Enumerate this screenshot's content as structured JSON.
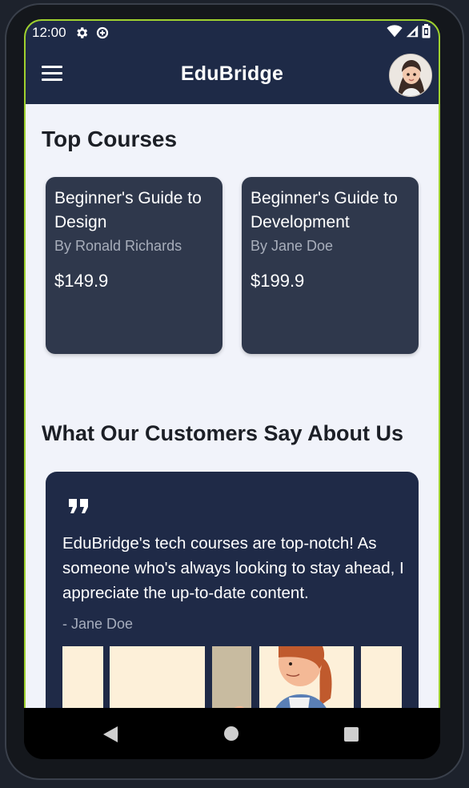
{
  "status_bar": {
    "time": "12:00",
    "icons": [
      "gear-icon",
      "data-saver-icon",
      "wifi-icon",
      "signal-icon",
      "battery-icon"
    ]
  },
  "app_bar": {
    "title": "EduBridge",
    "menu_icon": "hamburger-menu-icon",
    "avatar": "user-avatar"
  },
  "top_courses": {
    "heading": "Top Courses",
    "courses": [
      {
        "title": "Beginner's Guide to Design",
        "author": "By Ronald Richards",
        "price": "$149.9"
      },
      {
        "title": "Beginner's Guide to Development",
        "author": "By Jane Doe",
        "price": "$199.9"
      }
    ]
  },
  "testimonials": {
    "heading": "What Our Customers Say About Us",
    "items": [
      {
        "quote": "EduBridge's tech courses are top-notch! As someone who's always looking to stay ahead, I appreciate the up-to-date content.",
        "author": "- Jane Doe"
      }
    ]
  },
  "nav_bar": {
    "icons": [
      "back-icon",
      "home-icon",
      "recents-icon"
    ]
  },
  "colors": {
    "app_bar": "#1e2a47",
    "card": "#2f384c",
    "testimonial_card": "#1f2a47",
    "background": "#f1f3fa",
    "frame_accent": "#9fd12f"
  }
}
